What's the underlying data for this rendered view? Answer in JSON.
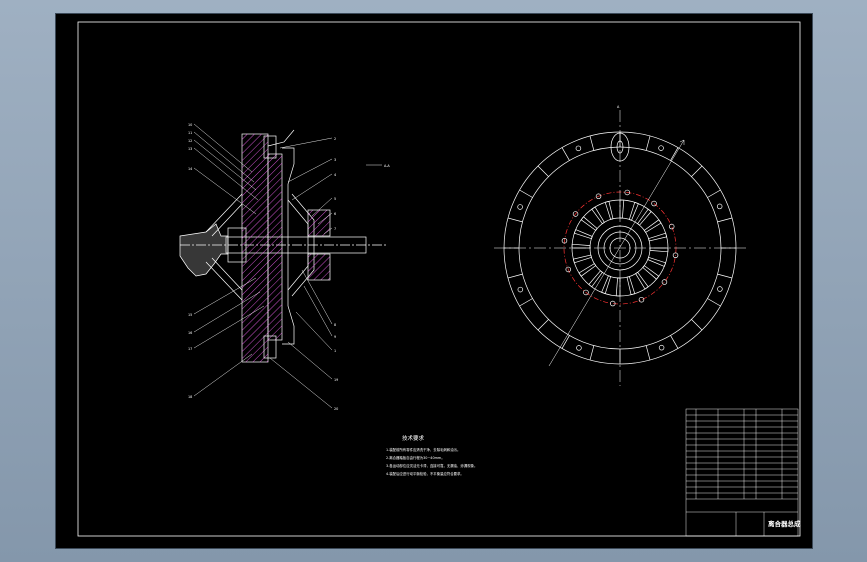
{
  "drawing": {
    "title": "离合器总成",
    "technical_requirements": {
      "heading": "技术要求",
      "items": [
        "1.装配前所有零件应清洗干净，去除毛刺和油污。",
        "2.离合器踏板自由行程为30~40mm。",
        "3.各运动部位应灵活无卡滞，连接可靠，无漏油、渗漏现象。",
        "4.装配后应进行动平衡检验，不平衡量应符合要求。"
      ]
    },
    "section_label": "A-A",
    "view_label": "A",
    "part_numbers_left": [
      "10",
      "11",
      "12",
      "13",
      "14",
      "15",
      "16",
      "17",
      "18"
    ],
    "part_numbers_right": [
      "2",
      "3",
      "4",
      "5",
      "6",
      "7",
      "8",
      "9",
      "1",
      "19",
      "20"
    ],
    "colors": {
      "sheet": "#000000",
      "outline": "#ffffff",
      "hatch": "#ff66ff",
      "center_line": "#ff3333",
      "part": "#dddddd"
    }
  }
}
